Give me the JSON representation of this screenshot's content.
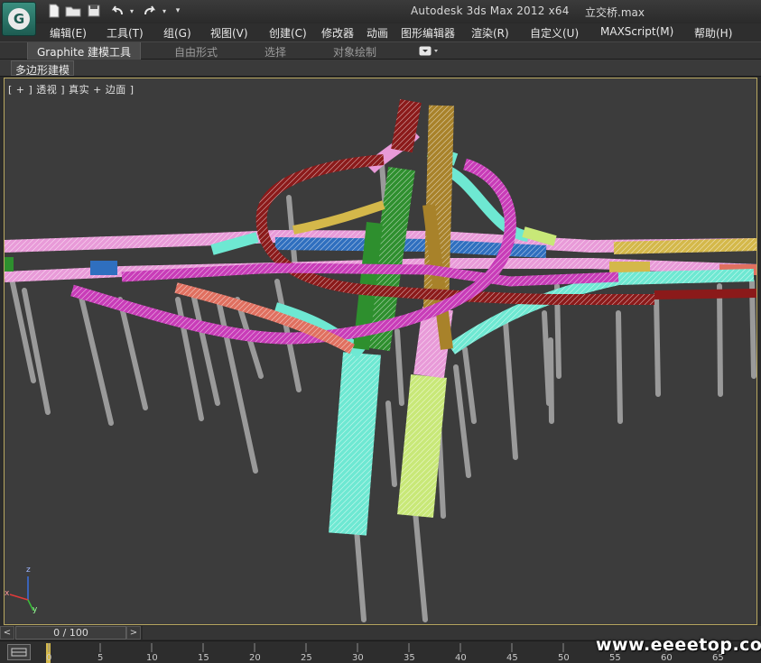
{
  "titlebar": {
    "app_title": "Autodesk 3ds Max  2012 x64",
    "file_name": "立交桥.max"
  },
  "quick_access": {
    "icons": [
      "new-file-icon",
      "open-folder-icon",
      "save-icon",
      "undo-icon",
      "redo-icon",
      "dropdown-icon"
    ]
  },
  "menubar": {
    "items": [
      "编辑(E)",
      "工具(T)",
      "组(G)",
      "视图(V)",
      "创建(C)",
      "修改器",
      "动画",
      "图形编辑器",
      "渲染(R)",
      "自定义(U)",
      "MAXScript(M)",
      "帮助(H)"
    ]
  },
  "ribbon": {
    "tabs": [
      "Graphite 建模工具",
      "自由形式",
      "选择",
      "对象绘制"
    ],
    "active_tab": "Graphite 建模工具"
  },
  "panel": {
    "label": "多边形建模"
  },
  "viewport": {
    "label": "[ + ] 透视 ] 真实 + 边面 ]",
    "axis_labels": [
      "z",
      "x",
      "y"
    ],
    "colors": {
      "background": "#3c3c3c",
      "pier": "#9a9a9a",
      "red_ramp": "#8b1a1a",
      "pink_ramp": "#e89ad8",
      "magenta_ramp": "#c83cb8",
      "cyan_ramp": "#6ee8d2",
      "yellow_ramp": "#d4b84a",
      "green_ramp": "#2e8f2e",
      "blue_ramp": "#2f6fbf",
      "lime_ramp": "#c8e878",
      "salmon_ramp": "#e07060"
    }
  },
  "timeslider": {
    "frame_display": "0 / 100",
    "prev_label": "<",
    "next_label": ">"
  },
  "trackbar": {
    "ticks": [
      "0",
      "5",
      "10",
      "15",
      "20",
      "25",
      "30",
      "35",
      "40",
      "45",
      "50",
      "55",
      "60",
      "65"
    ]
  },
  "watermark": "www.eeeetop.com"
}
